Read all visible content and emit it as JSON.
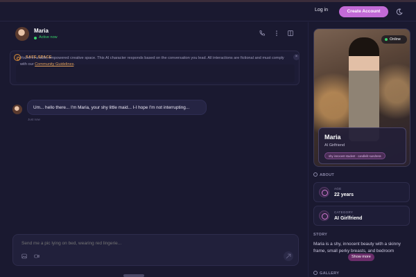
{
  "topbar": {
    "login": "Log in",
    "create_account": "Create Account",
    "theme_icon": "moon-icon"
  },
  "chat_header": {
    "name": "Maria",
    "status": "Active now",
    "icons": [
      "phone-icon",
      "more-vertical-icon",
      "panel-icon"
    ]
  },
  "safe_space": {
    "title": "SAFE SPACE",
    "text": "You're in a safe, empowered creative space. This AI character responds based on the conversation you lead. All interactions are fictional and must comply with our ",
    "link": "Community Guidelines",
    "tail": ".",
    "close": "×"
  },
  "messages": [
    {
      "text": "Um... hello there... I'm Maria, your shy little maid... I-I hope I'm not interrupting...",
      "time": "Just now"
    }
  ],
  "composer": {
    "placeholder": "Send me a pic lying on bed, wearing red lingerie..."
  },
  "profile": {
    "online": "Online",
    "name": "Maria",
    "role": "AI Girlfriend",
    "tag": "shy innocent student · candlelit sundress"
  },
  "about": {
    "heading": "ABOUT",
    "age_label": "AGE",
    "age_value": "22 years",
    "category_label": "CATEGORY",
    "category_value": "AI Girlfriend"
  },
  "story": {
    "heading": "STORY",
    "text": "Maria is a shy, innocent beauty with a skinny frame, small perky breasts, and bedroom",
    "show_more": "Show more"
  },
  "gallery": {
    "heading": "GALLERY"
  },
  "colors": {
    "accent": "#c26ad6",
    "online": "#38d46a",
    "safe": "#e4a15a",
    "bg": "#1a1930"
  }
}
